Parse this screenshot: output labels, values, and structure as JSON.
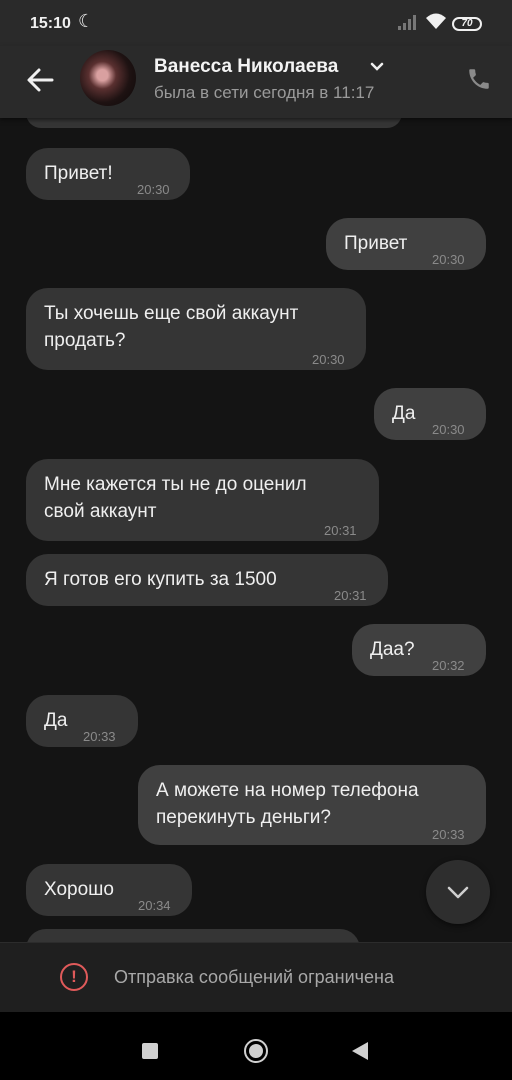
{
  "status_bar": {
    "time": "15:10",
    "battery": "70"
  },
  "header": {
    "name": "Ванесса Николаева",
    "subtitle": "была в сети сегодня в 11:17"
  },
  "messages": [
    {
      "dir": "in",
      "lines": [
        "Привет!"
      ],
      "time": "20:30"
    },
    {
      "dir": "out",
      "lines": [
        "Привет"
      ],
      "time": "20:30"
    },
    {
      "dir": "in",
      "lines": [
        "Ты хочешь еще свой аккаунт",
        "продать?"
      ],
      "time": "20:30"
    },
    {
      "dir": "out",
      "lines": [
        "Да"
      ],
      "time": "20:30"
    },
    {
      "dir": "in",
      "lines": [
        "Мне кажется ты не до оценил",
        "свой аккаунт"
      ],
      "time": "20:31"
    },
    {
      "dir": "in",
      "lines": [
        "Я готов его купить за 1500"
      ],
      "time": "20:31"
    },
    {
      "dir": "out",
      "lines": [
        "Даа?"
      ],
      "time": "20:32"
    },
    {
      "dir": "in",
      "lines": [
        "Да"
      ],
      "time": "20:33"
    },
    {
      "dir": "out",
      "lines": [
        "А можете на номер телефона",
        "перекинуть деньги?"
      ],
      "time": "20:33"
    },
    {
      "dir": "in",
      "lines": [
        "Хорошо"
      ],
      "time": "20:34"
    }
  ],
  "restriction_notice": "Отправка сообщений ограничена",
  "icons": {
    "back": "arrow-left-icon",
    "call": "phone-icon",
    "scroll": "chevron-down-icon",
    "warning": "exclamation-icon"
  }
}
